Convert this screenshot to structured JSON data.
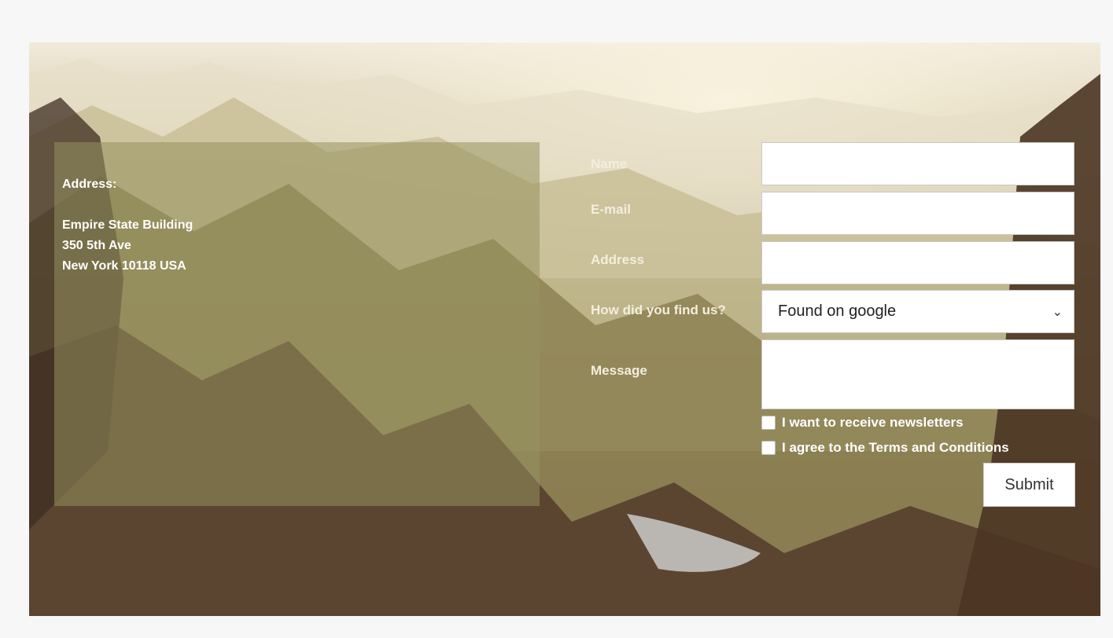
{
  "address_panel": {
    "heading": "Address:",
    "lines": [
      "Empire State Building",
      "350 5th Ave",
      "New York 10118 USA"
    ]
  },
  "form": {
    "name_label": "Name",
    "email_label": "E-mail",
    "address_label": "Address",
    "source_label": "How did you find us?",
    "source_value": "Found on google",
    "message_label": "Message",
    "newsletter_label": "I want to receive newsletters",
    "terms_label": "I agree to the Terms and Conditions",
    "submit_label": "Submit"
  },
  "icons": {
    "select_arrow": "chevron-down-icon"
  }
}
